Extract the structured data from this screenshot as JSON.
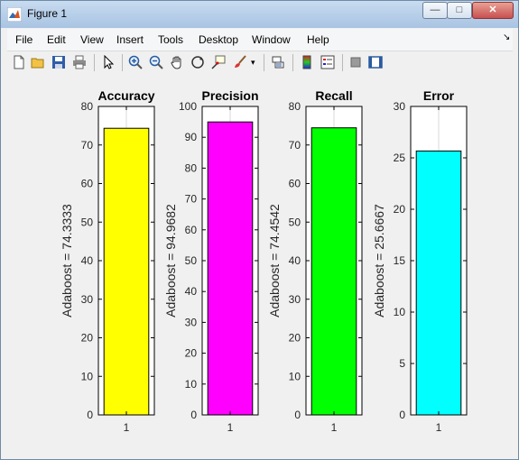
{
  "window": {
    "title": "Figure 1"
  },
  "menu": [
    "File",
    "Edit",
    "View",
    "Insert",
    "Tools",
    "Desktop",
    "Window",
    "Help"
  ],
  "toolbar_icons": [
    "new-figure-icon",
    "open-file-icon",
    "save-icon",
    "print-icon",
    "pointer-icon",
    "zoom-in-icon",
    "zoom-out-icon",
    "pan-icon",
    "rotate-icon",
    "data-cursor-icon",
    "brush-icon",
    "link-icon",
    "colorbar-icon",
    "legend-icon",
    "hide-plot-tools-icon",
    "show-plot-tools-icon"
  ],
  "chart_data": [
    {
      "type": "bar",
      "title": "Accuracy",
      "categories": [
        "1"
      ],
      "values": [
        74.3333
      ],
      "ylabel": "Adaboost  = 74.3333",
      "ylim": [
        0,
        80
      ],
      "yticks": [
        0,
        10,
        20,
        30,
        40,
        50,
        60,
        70,
        80
      ],
      "color": "#ffff00"
    },
    {
      "type": "bar",
      "title": "Precision",
      "categories": [
        "1"
      ],
      "values": [
        94.9682
      ],
      "ylabel": "Adaboost  = 94.9682",
      "ylim": [
        0,
        100
      ],
      "yticks": [
        0,
        10,
        20,
        30,
        40,
        50,
        60,
        70,
        80,
        90,
        100
      ],
      "color": "#ff00ff"
    },
    {
      "type": "bar",
      "title": "Recall",
      "categories": [
        "1"
      ],
      "values": [
        74.4542
      ],
      "ylabel": "Adaboost  = 74.4542",
      "ylim": [
        0,
        80
      ],
      "yticks": [
        0,
        10,
        20,
        30,
        40,
        50,
        60,
        70,
        80
      ],
      "color": "#00ff00"
    },
    {
      "type": "bar",
      "title": "Error",
      "categories": [
        "1"
      ],
      "values": [
        25.6667
      ],
      "ylabel": "Adaboost  = 25.6667",
      "ylim": [
        0,
        30
      ],
      "yticks": [
        0,
        5,
        10,
        15,
        20,
        25,
        30
      ],
      "color": "#00ffff"
    }
  ]
}
